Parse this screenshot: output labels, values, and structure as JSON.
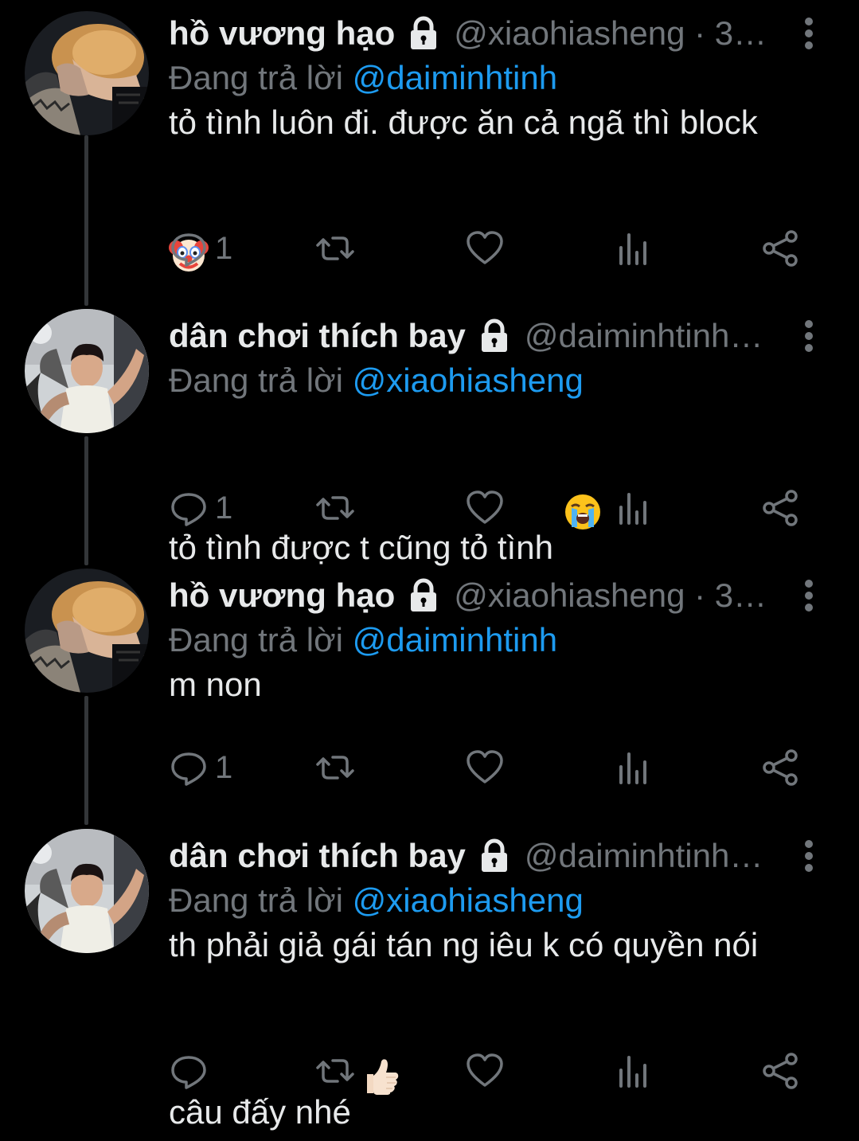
{
  "colors": {
    "background": "#000000",
    "text": "#e7e9ea",
    "muted": "#71767b",
    "link": "#1d9bf0",
    "thread_line": "#333639"
  },
  "replying_prefix": "Đang trả lời",
  "tweets": [
    {
      "name": "hồ vương hạo",
      "handle": "@xiaohiasheng · 3…",
      "reply_to": "@daiminhtinh",
      "text": "tỏ tình luôn đi. được ăn cả ngã thì block",
      "emoji": "clown-face-emoji",
      "reply_count": "1"
    },
    {
      "name": "dân chơi thích bay",
      "handle": "@daiminhtinh…",
      "reply_to": "@xiaohiasheng",
      "text": "tỏ tình được t cũng tỏ tình",
      "emoji": "loudly-crying-face-emoji",
      "reply_count": "1"
    },
    {
      "name": "hồ vương hạo",
      "handle": "@xiaohiasheng · 3…",
      "reply_to": "@daiminhtinh",
      "text": "m non",
      "emoji": "",
      "reply_count": "1"
    },
    {
      "name": "dân chơi thích bay",
      "handle": "@daiminhtinh…",
      "reply_to": "@xiaohiasheng",
      "text": "th phải giả gái tán ng iêu k có quyền nói câu đấy nhé",
      "emoji": "thumbs-up-emoji",
      "reply_count": ""
    }
  ],
  "icons": {
    "lock": "lock-icon",
    "more": "more-vertical-icon",
    "reply": "reply-icon",
    "retweet": "retweet-icon",
    "like": "heart-icon",
    "views": "views-icon",
    "share": "share-icon"
  }
}
